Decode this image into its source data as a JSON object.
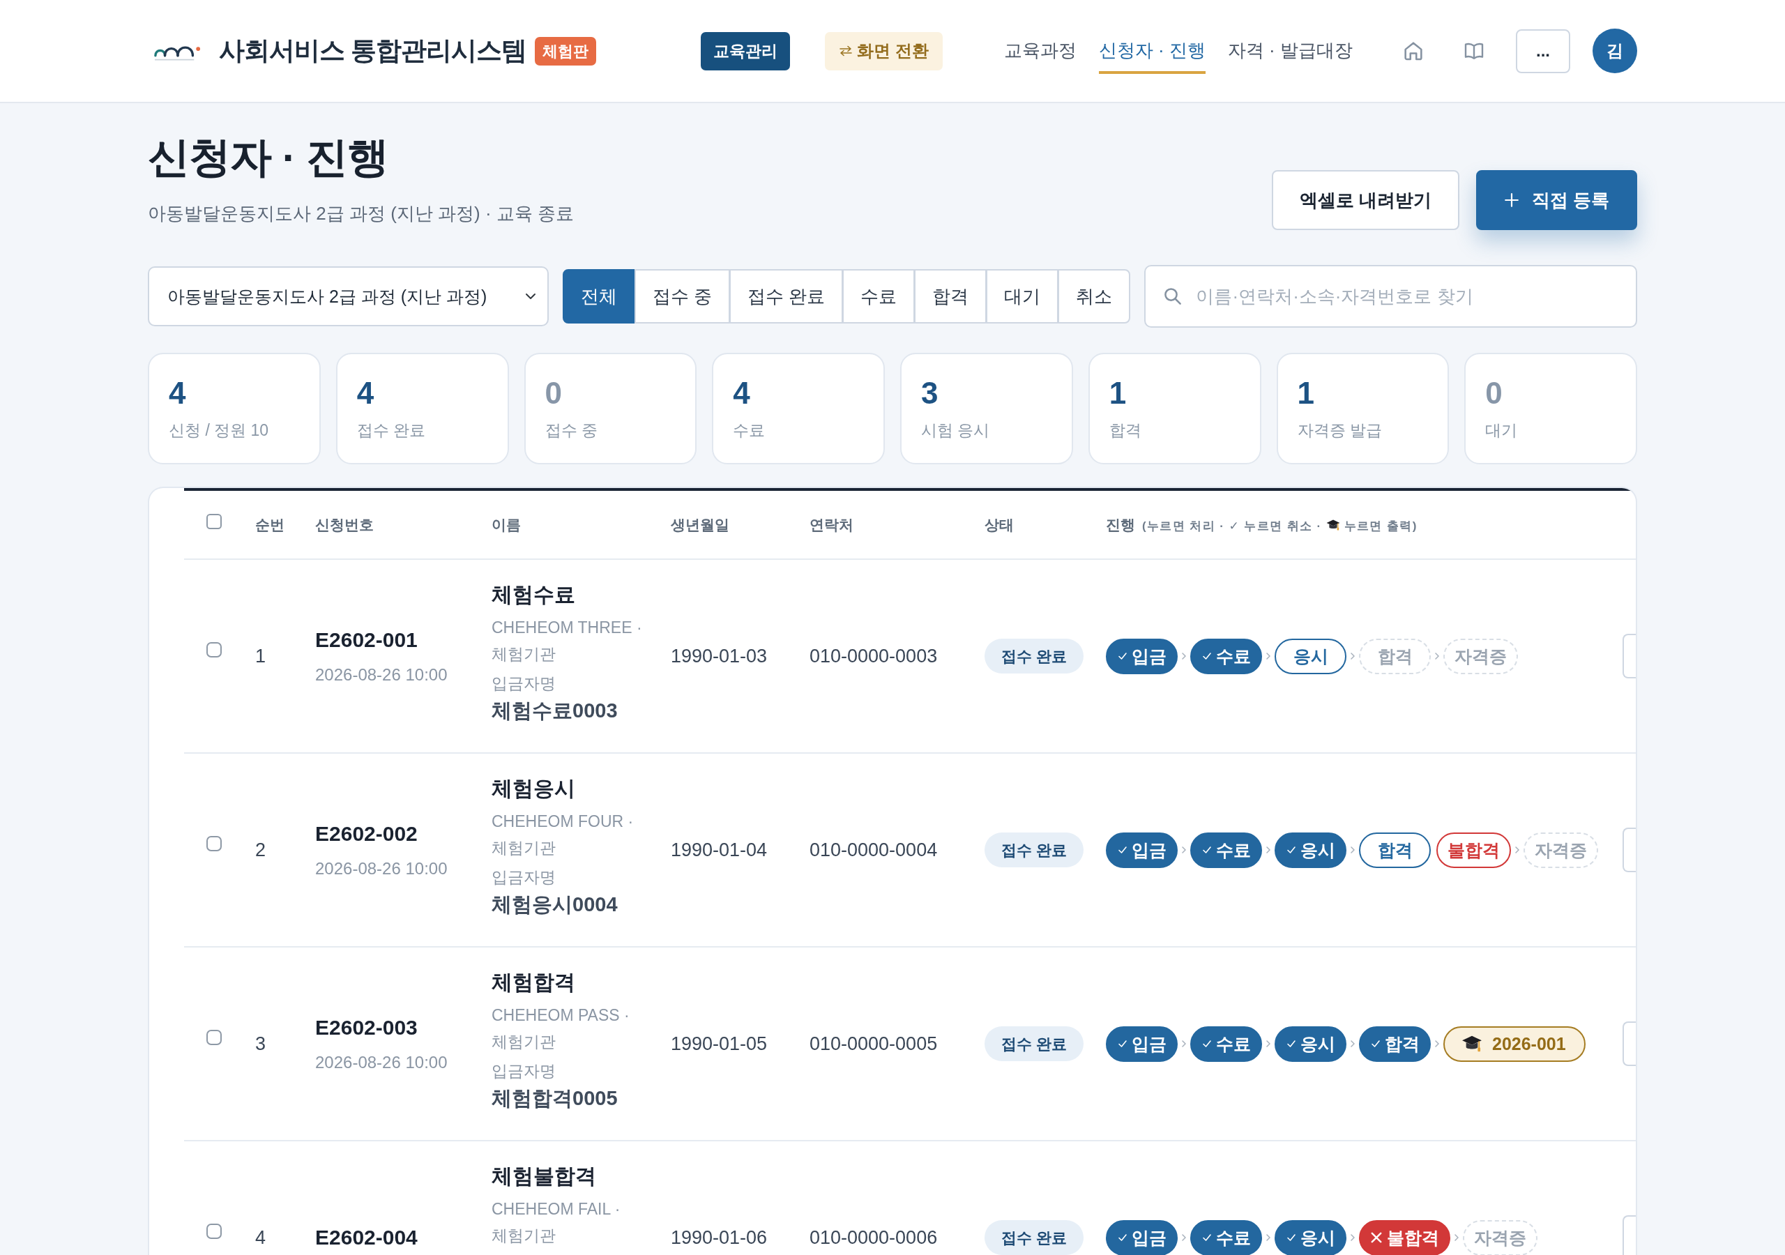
{
  "header": {
    "title": "사회서비스 통합관리시스템",
    "badge": "체험판",
    "section_button": "교육관리",
    "switch_button": "화면 전환",
    "nav": [
      {
        "label": "교육과정",
        "selected": false
      },
      {
        "label": "신청자 · 진행",
        "selected": true
      },
      {
        "label": "자격 · 발급대장",
        "selected": false
      }
    ],
    "more_button": "...",
    "avatar": "김"
  },
  "page": {
    "title": "신청자 · 진행",
    "subtitle": "아동발달운동지도사 2급 과정 (지난 과정) · 교육 종료",
    "actions": [
      {
        "label": "엑셀로 내려받기",
        "kind": "plain"
      },
      {
        "label": "직접 등록",
        "kind": "add"
      }
    ]
  },
  "filters": {
    "course": "아동발달운동지도사 2급 과정 (지난 과정)",
    "tabs": [
      {
        "label": "전체",
        "selected": true
      },
      {
        "label": "접수 중",
        "selected": false
      },
      {
        "label": "접수 완료",
        "selected": false
      },
      {
        "label": "수료",
        "selected": false
      },
      {
        "label": "합격",
        "selected": false
      },
      {
        "label": "대기",
        "selected": false
      },
      {
        "label": "취소",
        "selected": false
      }
    ],
    "search": {
      "placeholder": "이름·연락처·소속·자격번호로 찾기"
    }
  },
  "stats": [
    {
      "value": "4",
      "label": "신청 / 정원 10",
      "muted": false
    },
    {
      "value": "4",
      "label": "접수 완료",
      "muted": false
    },
    {
      "value": "0",
      "label": "접수 중",
      "muted": true
    },
    {
      "value": "4",
      "label": "수료",
      "muted": false
    },
    {
      "value": "3",
      "label": "시험 응시",
      "muted": false
    },
    {
      "value": "1",
      "label": "합격",
      "muted": false
    },
    {
      "value": "1",
      "label": "자격증 발급",
      "muted": false
    },
    {
      "value": "0",
      "label": "대기",
      "muted": true
    }
  ],
  "table": {
    "select_all": {
      "checked": false
    },
    "columns": [
      "순번",
      "신청번호",
      "이름",
      "생년월일",
      "연락처",
      "상태",
      "진행"
    ],
    "progress_hint": {
      "before_icon": "(누르면 처리 · ✓ 누르면 취소 ·",
      "after_icon": "누르면 출력)"
    },
    "rows": [
      {
        "checked": false,
        "no": "1",
        "application_no": "E2602-001",
        "applied_at": "2026-08-26 10:00",
        "name": "체험수료",
        "affiliation": "CHEHEOM THREE · 체험기관",
        "payer_label": "입금자명",
        "payer": "체험수료0003",
        "birth": "1990-01-03",
        "phone": "010-0000-0003",
        "status": "접수 완료",
        "steps": [
          {
            "label": "입금",
            "kind": "done",
            "chevron_after": true
          },
          {
            "label": "수료",
            "kind": "done",
            "chevron_after": true
          },
          {
            "label": "응시",
            "kind": "current",
            "chevron_after": true
          },
          {
            "label": "합격",
            "kind": "pending",
            "chevron_after": true
          },
          {
            "label": "자격증",
            "kind": "pending",
            "chevron_after": false
          }
        ]
      },
      {
        "checked": false,
        "no": "2",
        "application_no": "E2602-002",
        "applied_at": "2026-08-26 10:00",
        "name": "체험응시",
        "affiliation": "CHEHEOM FOUR · 체험기관",
        "payer_label": "입금자명",
        "payer": "체험응시0004",
        "birth": "1990-01-04",
        "phone": "010-0000-0004",
        "status": "접수 완료",
        "steps": [
          {
            "label": "입금",
            "kind": "done",
            "chevron_after": true
          },
          {
            "label": "수료",
            "kind": "done",
            "chevron_after": true
          },
          {
            "label": "응시",
            "kind": "done",
            "chevron_after": true
          },
          {
            "label": "합격",
            "kind": "current",
            "chevron_after": false
          },
          {
            "label": "불합격",
            "kind": "fail_option",
            "chevron_after": true
          },
          {
            "label": "자격증",
            "kind": "pending",
            "chevron_after": false
          }
        ]
      },
      {
        "checked": false,
        "no": "3",
        "application_no": "E2602-003",
        "applied_at": "2026-08-26 10:00",
        "name": "체험합격",
        "affiliation": "CHEHEOM PASS · 체험기관",
        "payer_label": "입금자명",
        "payer": "체험합격0005",
        "birth": "1990-01-05",
        "phone": "010-0000-0005",
        "status": "접수 완료",
        "steps": [
          {
            "label": "입금",
            "kind": "done",
            "chevron_after": true
          },
          {
            "label": "수료",
            "kind": "done",
            "chevron_after": true
          },
          {
            "label": "응시",
            "kind": "done",
            "chevron_after": true
          },
          {
            "label": "합격",
            "kind": "done",
            "chevron_after": true
          },
          {
            "label": "2026-001",
            "kind": "certificate",
            "chevron_after": false
          }
        ]
      },
      {
        "checked": false,
        "no": "4",
        "application_no": "E2602-004",
        "name": "체험불합격",
        "affiliation": "CHEHEOM FAIL · 체험기관",
        "birth": "1990-01-06",
        "phone": "010-0000-0006",
        "status": "접수 완료",
        "steps": [
          {
            "label": "입금",
            "kind": "done",
            "chevron_after": true
          },
          {
            "label": "수료",
            "kind": "done",
            "chevron_after": true
          },
          {
            "label": "응시",
            "kind": "done",
            "chevron_after": true
          },
          {
            "label": "불합격",
            "kind": "failed",
            "chevron_after": true
          },
          {
            "label": "자격증",
            "kind": "pending",
            "chevron_after": false
          }
        ]
      }
    ]
  }
}
